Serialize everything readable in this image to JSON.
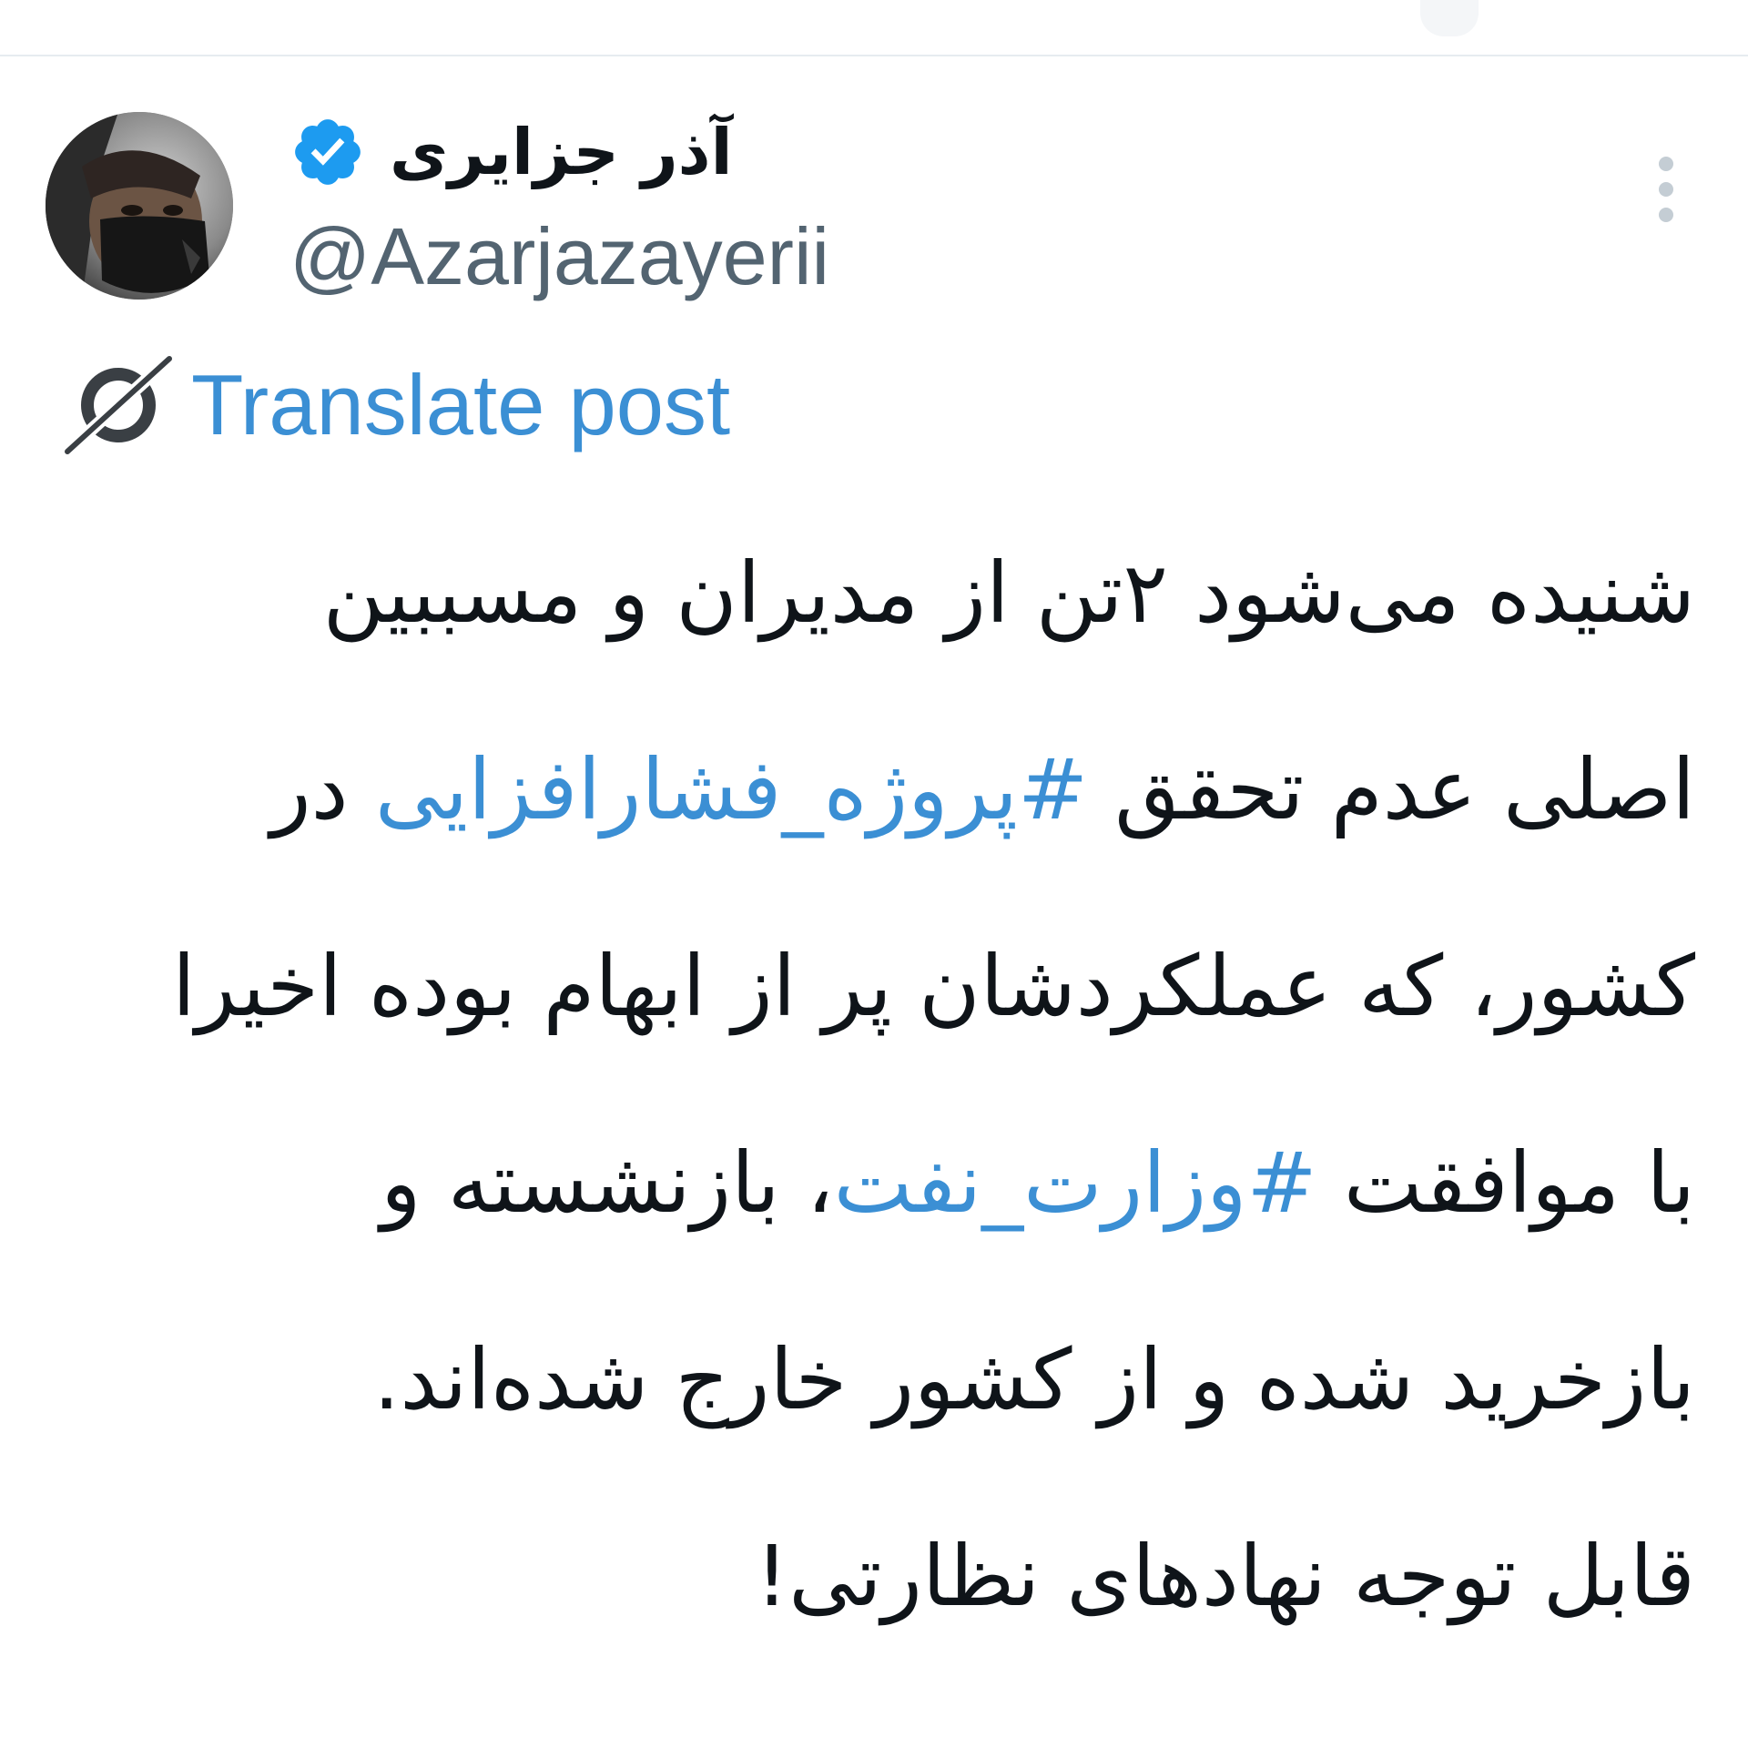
{
  "author": {
    "display_name": "آذر جزایری",
    "handle": "@Azarjazayerii",
    "verified": true,
    "avatar_icon": "profile-photo"
  },
  "menu": {
    "icon": "more-vertical-icon"
  },
  "translate": {
    "label": "Translate post",
    "icon": "translate-icon"
  },
  "post": {
    "lines": [
      [
        {
          "text": "شنیده می‌شود ۲تن از مدیران و مسببین",
          "hashtag": false
        }
      ],
      [
        {
          "text": "اصلی عدم تحقق ",
          "hashtag": false
        },
        {
          "text": "#پروژه_فشارافزایی",
          "hashtag": true
        },
        {
          "text": " در",
          "hashtag": false
        }
      ],
      [
        {
          "text": "کشور، که عملکردشان پر از ابهام بوده اخیرا",
          "hashtag": false
        }
      ],
      [
        {
          "text": "با موافقت ",
          "hashtag": false
        },
        {
          "text": "#وزارت_نفت",
          "hashtag": true
        },
        {
          "text": "، بازنشسته و",
          "hashtag": false
        }
      ],
      [
        {
          "text": "بازخرید شده و از کشور خارج شده‌اند.",
          "hashtag": false
        }
      ],
      [
        {
          "text": "قابل توجه نهادهای نظارتی!",
          "hashtag": false
        }
      ]
    ]
  },
  "colors": {
    "text": "#0f1419",
    "secondary": "#536471",
    "accent": "#3b8fd4",
    "verified_badge": "#1d9bf0"
  }
}
